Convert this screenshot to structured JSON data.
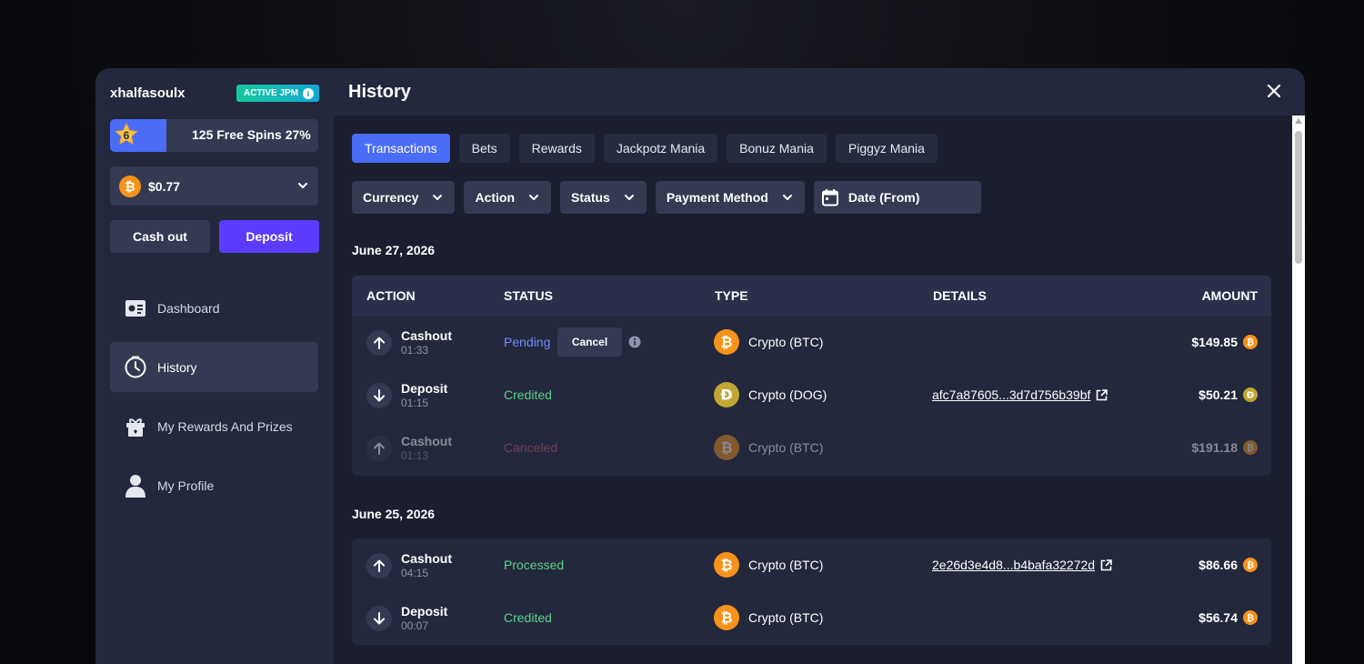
{
  "user": {
    "name": "xhalfasoulx",
    "badge": "ACTIVE JPM"
  },
  "spins": {
    "level": "6",
    "label": "125 Free Spins 27%",
    "progress": 0.27
  },
  "balance": {
    "amount": "$0.77"
  },
  "buttons": {
    "cashout": "Cash out",
    "deposit": "Deposit"
  },
  "nav": [
    {
      "label": "Dashboard",
      "icon": "dashboard-icon"
    },
    {
      "label": "History",
      "icon": "clock-icon"
    },
    {
      "label": "My Rewards And Prizes",
      "icon": "gift-icon"
    },
    {
      "label": "My Profile",
      "icon": "user-icon"
    }
  ],
  "header": {
    "title": "History"
  },
  "tabs": [
    "Transactions",
    "Bets",
    "Rewards",
    "Jackpotz Mania",
    "Bonuz Mania",
    "Piggyz Mania"
  ],
  "filters": [
    "Currency",
    "Action",
    "Status",
    "Payment Method"
  ],
  "date_filter": "Date (From)",
  "columns": [
    "ACTION",
    "STATUS",
    "TYPE",
    "DETAILS",
    "AMOUNT"
  ],
  "cancel_label": "Cancel",
  "groups": [
    {
      "date": "June 27, 2026",
      "rows": [
        {
          "action": "Cashout",
          "time": "01:33",
          "status": "Pending",
          "type": "Crypto (BTC)",
          "details": "",
          "amount": "$149.85"
        },
        {
          "action": "Deposit",
          "time": "01:15",
          "status": "Credited",
          "type": "Crypto (DOG)",
          "details": "afc7a87605...3d7d756b39bf",
          "amount": "$50.21"
        },
        {
          "action": "Cashout",
          "time": "01:13",
          "status": "Canceled",
          "type": "Crypto (BTC)",
          "details": "",
          "amount": "$191.18"
        }
      ]
    },
    {
      "date": "June 25, 2026",
      "rows": [
        {
          "action": "Cashout",
          "time": "04:15",
          "status": "Processed",
          "type": "Crypto (BTC)",
          "details": "2e26d3e4d8...b4bafa32272d",
          "amount": "$86.66"
        },
        {
          "action": "Deposit",
          "time": "00:07",
          "status": "Credited",
          "type": "Crypto (BTC)",
          "details": "",
          "amount": "$56.74"
        }
      ]
    }
  ],
  "colors": {
    "accent": "#4a6cf7",
    "deposit": "#5b3bff",
    "btc": "#f7931a",
    "dog": "#c2a633",
    "credited": "#5bd08a",
    "pending": "#6f8dff",
    "canceled": "#e05a7a"
  }
}
